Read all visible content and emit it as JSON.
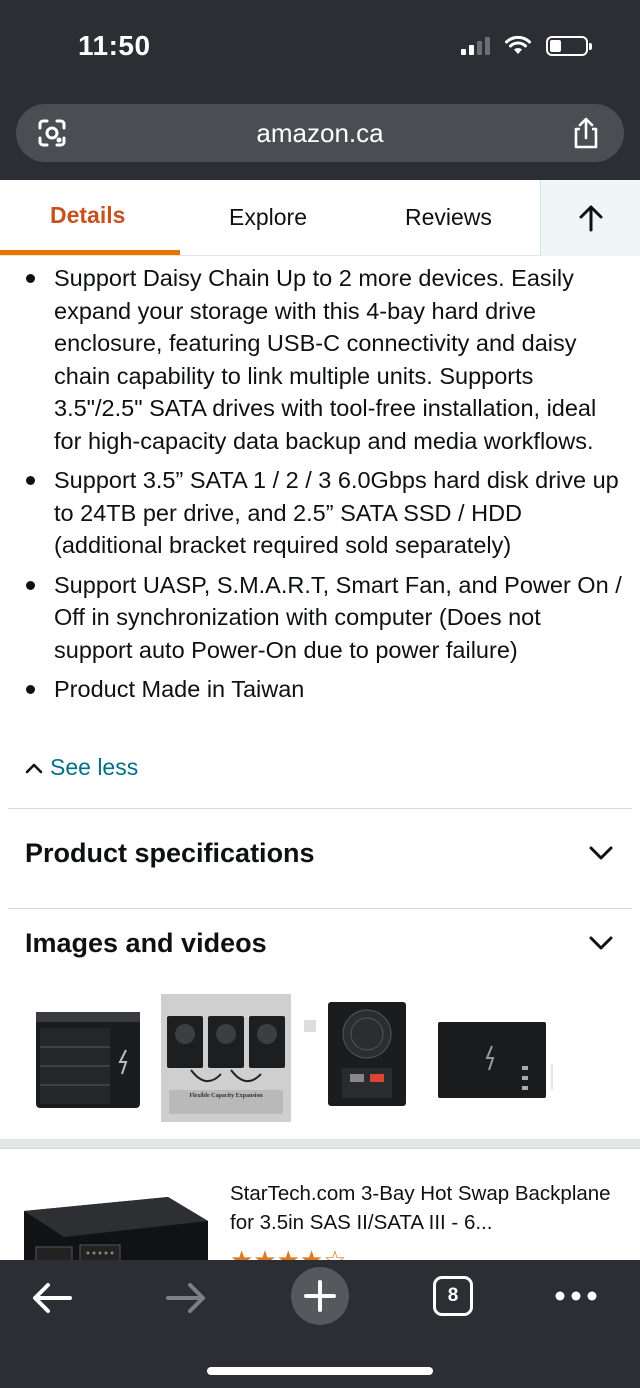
{
  "status": {
    "time": "11:50"
  },
  "browser": {
    "url": "amazon.ca",
    "tab_count": "8"
  },
  "tabs": {
    "details": "Details",
    "explore": "Explore",
    "reviews": "Reviews"
  },
  "bullets": [
    "Support Daisy Chain Up to 2 more devices. Easily expand your storage with this 4-bay hard drive enclosure, featuring USB-C connectivity and daisy chain capability to link multiple units. Supports 3.5\"/2.5\" SATA drives with tool-free installation, ideal for high-capacity data backup and media workflows.",
    "Support 3.5” SATA 1 / 2 / 3 6.0Gbps hard disk drive up to 24TB per drive, and 2.5” SATA SSD / HDD (additional bracket required sold separately)",
    "Support UASP, S.M.A.R.T, Smart Fan, and Power On / Off in synchronization with computer (Does not support auto Power-On due to power failure)",
    "Product Made in Taiwan"
  ],
  "see_less": "See less",
  "sections": {
    "product_specs": "Product specifications",
    "images_videos": "Images and videos"
  },
  "thumbnails": {
    "thumb2_caption": "Flexible Capacity Expansion"
  },
  "recommendation": {
    "title": "StarTech.com 3-Bay Hot Swap Backplane for 3.5in SAS II/SATA III - 6...",
    "stars": "★★★★☆"
  },
  "icons": {
    "lens": "camera-lens-icon",
    "share": "share-icon",
    "scroll_top": "arrow-up-icon",
    "see_less": "caret-up-icon",
    "chevron": "chevron-down-icon",
    "back": "back-arrow-icon",
    "forward": "forward-arrow-icon",
    "new_tab": "plus-icon",
    "tabs": "tabs-icon",
    "more": "more-icon"
  },
  "colors": {
    "accent_orange": "#e77600",
    "active_tab_text": "#c7511f",
    "link": "#007185",
    "chrome_bg": "#2b2f33"
  }
}
